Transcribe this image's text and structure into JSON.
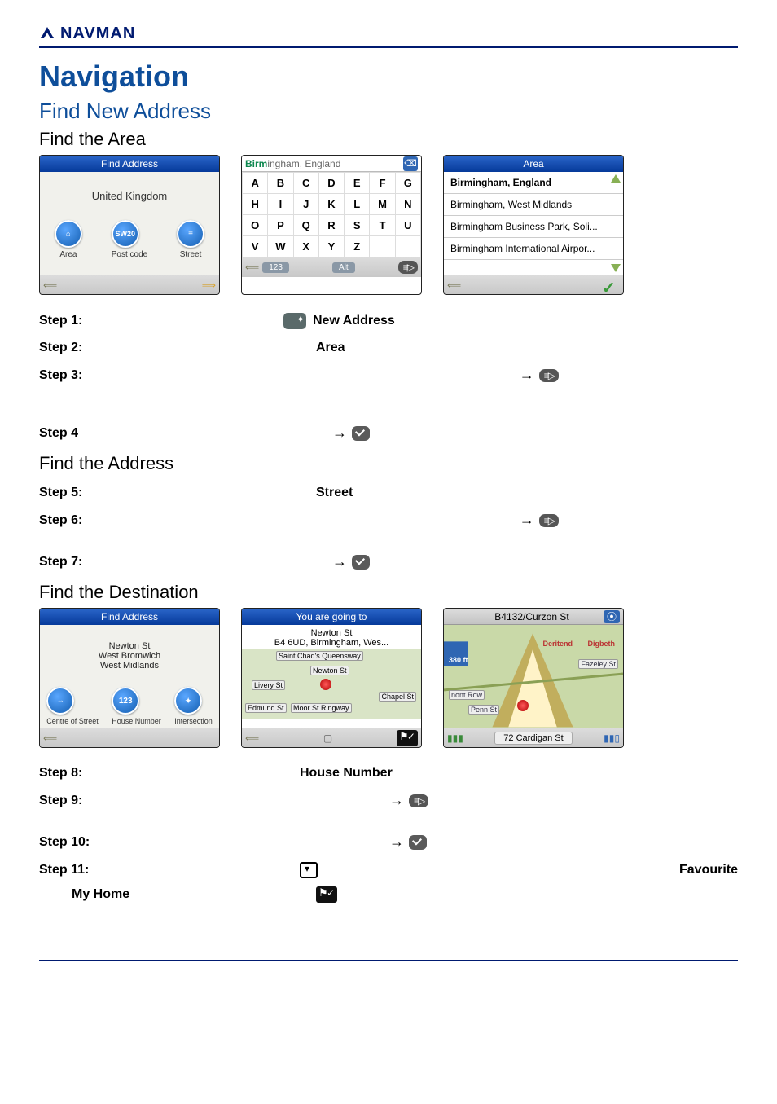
{
  "header": {
    "brand": "NAVMAN"
  },
  "titles": {
    "navigation": "Navigation",
    "find_new_address": "Find New Address",
    "find_the_area": "Find the Area",
    "find_the_address": "Find the Address",
    "find_the_destination": "Find the Destination"
  },
  "screens_a": {
    "left": {
      "title": "Find Address",
      "country": "United Kingdom",
      "icons": [
        {
          "label": "Area"
        },
        {
          "label": "Post code"
        },
        {
          "label": "Street"
        }
      ]
    },
    "keyboard": {
      "typed_prefix": "Birm",
      "typed_rest": "ingham, England",
      "keys": [
        [
          "A",
          "B",
          "C",
          "D",
          "E",
          "F",
          "G"
        ],
        [
          "H",
          "I",
          "J",
          "K",
          "L",
          "M",
          "N"
        ],
        [
          "O",
          "P",
          "Q",
          "R",
          "S",
          "T",
          "U"
        ],
        [
          "V",
          "W",
          "X",
          "Y",
          "Z",
          "",
          ""
        ]
      ],
      "num_btn": "123",
      "alt_btn": "Alt"
    },
    "list": {
      "title": "Area",
      "items": [
        "Birmingham, England",
        "Birmingham, West Midlands",
        "Birmingham Business Park, Soli...",
        "Birmingham International Airpor..."
      ]
    }
  },
  "steps_a": {
    "s1": {
      "label": "Step 1:",
      "action": "New Address"
    },
    "s2": {
      "label": "Step 2:",
      "action": "Area"
    },
    "s3": {
      "label": "Step 3:"
    },
    "s4": {
      "label": "Step 4"
    },
    "s5": {
      "label": "Step 5:",
      "action": "Street"
    },
    "s6": {
      "label": "Step 6:"
    },
    "s7": {
      "label": "Step 7:"
    }
  },
  "screens_b": {
    "left": {
      "title": "Find Address",
      "lines": [
        "Newton St",
        "West Bromwich",
        "West Midlands"
      ],
      "icons": [
        {
          "label": "Centre of Street"
        },
        {
          "label": "House Number"
        },
        {
          "label": "Intersection"
        }
      ]
    },
    "preview": {
      "title": "You are going to",
      "lines": [
        "Newton St",
        "B4 6UD, Birmingham, Wes..."
      ],
      "roads": [
        "Saint Chad's Queensway",
        "Newton St",
        "Livery St",
        "Edmund St",
        "Moor St Ringway",
        "Chapel St"
      ]
    },
    "map3d": {
      "top_road": "B4132/Curzon St",
      "distance": "380 ft",
      "labels": [
        "Deritend",
        "Digbeth",
        "Fazeley St",
        "nont Row",
        "Penn St"
      ],
      "bottom": "72 Cardigan St"
    }
  },
  "steps_b": {
    "s8": {
      "label": "Step 8:",
      "action": "House Number"
    },
    "s9": {
      "label": "Step 9:"
    },
    "s10": {
      "label": "Step 10:"
    },
    "s11": {
      "label": "Step 11:",
      "right": "Favourite",
      "sub": "My Home"
    }
  }
}
